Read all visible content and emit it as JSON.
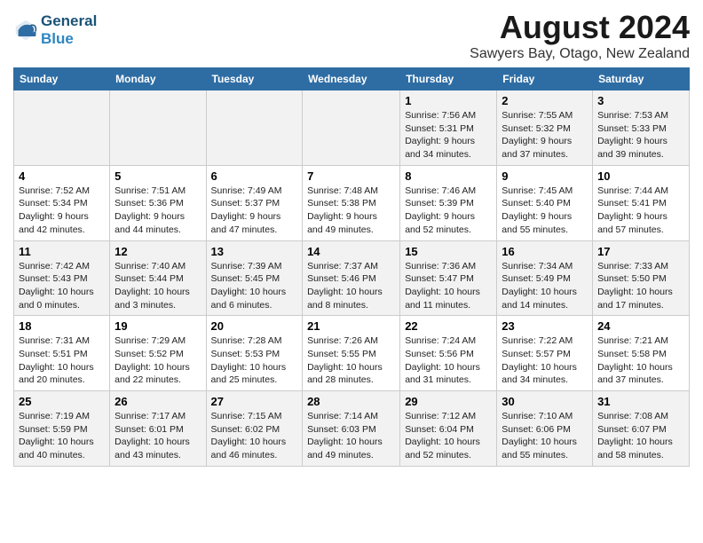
{
  "header": {
    "logo_line1": "General",
    "logo_line2": "Blue",
    "title": "August 2024",
    "subtitle": "Sawyers Bay, Otago, New Zealand"
  },
  "days_of_week": [
    "Sunday",
    "Monday",
    "Tuesday",
    "Wednesday",
    "Thursday",
    "Friday",
    "Saturday"
  ],
  "weeks": [
    [
      {
        "day": "",
        "info": ""
      },
      {
        "day": "",
        "info": ""
      },
      {
        "day": "",
        "info": ""
      },
      {
        "day": "",
        "info": ""
      },
      {
        "day": "1",
        "info": "Sunrise: 7:56 AM\nSunset: 5:31 PM\nDaylight: 9 hours\nand 34 minutes."
      },
      {
        "day": "2",
        "info": "Sunrise: 7:55 AM\nSunset: 5:32 PM\nDaylight: 9 hours\nand 37 minutes."
      },
      {
        "day": "3",
        "info": "Sunrise: 7:53 AM\nSunset: 5:33 PM\nDaylight: 9 hours\nand 39 minutes."
      }
    ],
    [
      {
        "day": "4",
        "info": "Sunrise: 7:52 AM\nSunset: 5:34 PM\nDaylight: 9 hours\nand 42 minutes."
      },
      {
        "day": "5",
        "info": "Sunrise: 7:51 AM\nSunset: 5:36 PM\nDaylight: 9 hours\nand 44 minutes."
      },
      {
        "day": "6",
        "info": "Sunrise: 7:49 AM\nSunset: 5:37 PM\nDaylight: 9 hours\nand 47 minutes."
      },
      {
        "day": "7",
        "info": "Sunrise: 7:48 AM\nSunset: 5:38 PM\nDaylight: 9 hours\nand 49 minutes."
      },
      {
        "day": "8",
        "info": "Sunrise: 7:46 AM\nSunset: 5:39 PM\nDaylight: 9 hours\nand 52 minutes."
      },
      {
        "day": "9",
        "info": "Sunrise: 7:45 AM\nSunset: 5:40 PM\nDaylight: 9 hours\nand 55 minutes."
      },
      {
        "day": "10",
        "info": "Sunrise: 7:44 AM\nSunset: 5:41 PM\nDaylight: 9 hours\nand 57 minutes."
      }
    ],
    [
      {
        "day": "11",
        "info": "Sunrise: 7:42 AM\nSunset: 5:43 PM\nDaylight: 10 hours\nand 0 minutes."
      },
      {
        "day": "12",
        "info": "Sunrise: 7:40 AM\nSunset: 5:44 PM\nDaylight: 10 hours\nand 3 minutes."
      },
      {
        "day": "13",
        "info": "Sunrise: 7:39 AM\nSunset: 5:45 PM\nDaylight: 10 hours\nand 6 minutes."
      },
      {
        "day": "14",
        "info": "Sunrise: 7:37 AM\nSunset: 5:46 PM\nDaylight: 10 hours\nand 8 minutes."
      },
      {
        "day": "15",
        "info": "Sunrise: 7:36 AM\nSunset: 5:47 PM\nDaylight: 10 hours\nand 11 minutes."
      },
      {
        "day": "16",
        "info": "Sunrise: 7:34 AM\nSunset: 5:49 PM\nDaylight: 10 hours\nand 14 minutes."
      },
      {
        "day": "17",
        "info": "Sunrise: 7:33 AM\nSunset: 5:50 PM\nDaylight: 10 hours\nand 17 minutes."
      }
    ],
    [
      {
        "day": "18",
        "info": "Sunrise: 7:31 AM\nSunset: 5:51 PM\nDaylight: 10 hours\nand 20 minutes."
      },
      {
        "day": "19",
        "info": "Sunrise: 7:29 AM\nSunset: 5:52 PM\nDaylight: 10 hours\nand 22 minutes."
      },
      {
        "day": "20",
        "info": "Sunrise: 7:28 AM\nSunset: 5:53 PM\nDaylight: 10 hours\nand 25 minutes."
      },
      {
        "day": "21",
        "info": "Sunrise: 7:26 AM\nSunset: 5:55 PM\nDaylight: 10 hours\nand 28 minutes."
      },
      {
        "day": "22",
        "info": "Sunrise: 7:24 AM\nSunset: 5:56 PM\nDaylight: 10 hours\nand 31 minutes."
      },
      {
        "day": "23",
        "info": "Sunrise: 7:22 AM\nSunset: 5:57 PM\nDaylight: 10 hours\nand 34 minutes."
      },
      {
        "day": "24",
        "info": "Sunrise: 7:21 AM\nSunset: 5:58 PM\nDaylight: 10 hours\nand 37 minutes."
      }
    ],
    [
      {
        "day": "25",
        "info": "Sunrise: 7:19 AM\nSunset: 5:59 PM\nDaylight: 10 hours\nand 40 minutes."
      },
      {
        "day": "26",
        "info": "Sunrise: 7:17 AM\nSunset: 6:01 PM\nDaylight: 10 hours\nand 43 minutes."
      },
      {
        "day": "27",
        "info": "Sunrise: 7:15 AM\nSunset: 6:02 PM\nDaylight: 10 hours\nand 46 minutes."
      },
      {
        "day": "28",
        "info": "Sunrise: 7:14 AM\nSunset: 6:03 PM\nDaylight: 10 hours\nand 49 minutes."
      },
      {
        "day": "29",
        "info": "Sunrise: 7:12 AM\nSunset: 6:04 PM\nDaylight: 10 hours\nand 52 minutes."
      },
      {
        "day": "30",
        "info": "Sunrise: 7:10 AM\nSunset: 6:06 PM\nDaylight: 10 hours\nand 55 minutes."
      },
      {
        "day": "31",
        "info": "Sunrise: 7:08 AM\nSunset: 6:07 PM\nDaylight: 10 hours\nand 58 minutes."
      }
    ]
  ]
}
